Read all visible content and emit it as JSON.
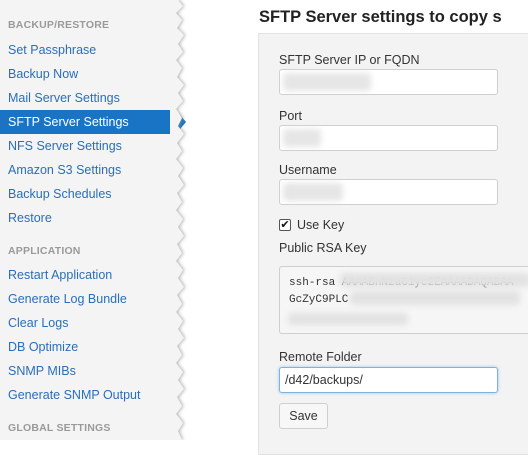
{
  "sidebar": {
    "sections": [
      {
        "heading": "BACKUP/RESTORE",
        "items": [
          "Set Passphrase",
          "Backup Now",
          "Mail Server Settings",
          "SFTP Server Settings",
          "NFS Server Settings",
          "Amazon S3 Settings",
          "Backup Schedules",
          "Restore"
        ]
      },
      {
        "heading": "APPLICATION",
        "items": [
          "Restart Application",
          "Generate Log Bundle",
          "Clear Logs",
          "DB Optimize",
          "SNMP MIBs",
          "Generate SNMP Output"
        ]
      },
      {
        "heading": "GLOBAL SETTINGS",
        "items": []
      }
    ],
    "active_item": "SFTP Server Settings"
  },
  "main": {
    "title": "SFTP Server settings to copy s",
    "form": {
      "server_label": "SFTP Server IP or FQDN",
      "port_label": "Port",
      "username_label": "Username",
      "use_key_label": "Use Key",
      "use_key_checked": true,
      "public_key_label": "Public RSA Key",
      "key_line1": "ssh-rsa AAAABnNzaC1yc2EAAAADAQABAA",
      "key_line2": "GcZyC9PLC",
      "remote_folder_label": "Remote Folder",
      "remote_folder_value": "/d42/backups/",
      "save_label": "Save"
    }
  },
  "colors": {
    "accent": "#1a74c6",
    "link": "#2a6ebb"
  }
}
